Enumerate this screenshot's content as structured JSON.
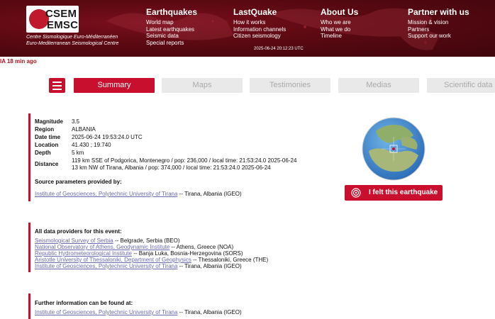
{
  "header": {
    "logo": {
      "line1": "CSEM",
      "line2": "EMSC"
    },
    "subtitle_fr": "Centre Sismologique Euro-Méditerranéen",
    "subtitle_en": "Euro-Mediterranean Seismological Centre",
    "nav": [
      {
        "title": "Earthquakes",
        "items": [
          "World map",
          "Latest earthquakes",
          "Seismic data",
          "Special reports"
        ]
      },
      {
        "title": "LastQuake",
        "items": [
          "How it works",
          "Information channels",
          "Citizen seismology"
        ]
      },
      {
        "title": "About Us",
        "items": [
          "Who we are",
          "What we do",
          "Timeline"
        ]
      },
      {
        "title": "Partner with us",
        "items": [
          "Mission & vision",
          "Partners",
          "Support our work"
        ]
      }
    ],
    "utc_time": "2025-06-24 20:12:23 UTC"
  },
  "ago_text": "IA 18 min ago",
  "tabs": [
    "Summary",
    "Maps",
    "Testimonies",
    "Medias",
    "Scientific data"
  ],
  "active_tab": "Summary",
  "event": {
    "rows": [
      {
        "label": "Magnitude",
        "value": "3.5"
      },
      {
        "label": "Region",
        "value": "ALBANIA"
      },
      {
        "label": "Date time",
        "value": "2025-06-24 19:53:24.0 UTC"
      },
      {
        "label": "Location",
        "value": "41.430 ; 19.740"
      },
      {
        "label": "Depth",
        "value": "5 km"
      }
    ],
    "distance_label": "Distance",
    "distance_lines": [
      "119 km SSE of Podgorica, Montenegro / pop: 236,000 / local time: 21:53:24.0 2025-06-24",
      "13 km NW of Tirana, Albania / pop: 374,000 / local time: 21:53:24.0 2025-06-24"
    ]
  },
  "source": {
    "title": "Source parameters provided by:",
    "link": "Institute of Geosciences, Polytechnic University of Tirana",
    "suffix": " -- Tirana, Albania (IGEO)"
  },
  "felt_button": "I felt this earthquake",
  "providers": {
    "title": "All data providers for this event:",
    "items": [
      {
        "link": "Seismological Survey of Serbia",
        "suffix": " -- Belgrade, Serbia (BEO)"
      },
      {
        "link": "National Observatory of Athens, Geodynamic Institute",
        "suffix": " -- Athens, Greece (NOA)"
      },
      {
        "link": "Republic Hydrometeorological Institute",
        "suffix": " -- Banja Luka, Bosnia-Herzegovina (SORS)"
      },
      {
        "link": "Aristotle University of Thessaloniki, Department of Geophysics",
        "suffix": " -- Thessaloniki, Greece (THE)"
      },
      {
        "link": "Institute of Geosciences, Polytechnic University of Tirana",
        "suffix": " -- Tirana, Albania (IGEO)"
      }
    ]
  },
  "further": {
    "title": "Further information can be found at:",
    "link": "Institute of Geosciences, Polytechnic University of Tirana",
    "suffix": " -- Tirana, Albania (IGEO)"
  },
  "colors": {
    "brand_red": "#c8102e",
    "header_dark": "#5a0912",
    "link": "#6b6bb0"
  }
}
